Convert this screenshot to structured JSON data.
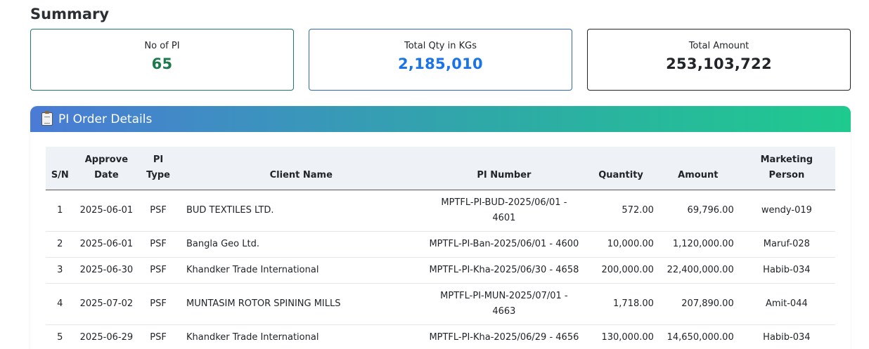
{
  "summary": {
    "title": "Summary",
    "cards": [
      {
        "label": "No of PI",
        "value": "65"
      },
      {
        "label": "Total Qty in KGs",
        "value": "2,185,010"
      },
      {
        "label": "Total Amount",
        "value": "253,103,722"
      }
    ]
  },
  "panel": {
    "icon": "clipboard-icon",
    "title": "PI Order Details"
  },
  "table": {
    "headers": {
      "sn": "S/N",
      "approve_date": "Approve Date",
      "pi_type": "PI Type",
      "client_name": "Client Name",
      "pi_number": "PI Number",
      "quantity": "Quantity",
      "amount": "Amount",
      "marketing_person": "Marketing Person"
    },
    "rows": [
      {
        "sn": "1",
        "date": "2025-06-01",
        "type": "PSF",
        "client": "BUD TEXTILES LTD.",
        "pi": "MPTFL-PI-BUD-2025/06/01 - 4601",
        "qty": "572.00",
        "amount": "69,796.00",
        "person": "wendy-019"
      },
      {
        "sn": "2",
        "date": "2025-06-01",
        "type": "PSF",
        "client": "Bangla Geo Ltd.",
        "pi": "MPTFL-PI-Ban-2025/06/01 - 4600",
        "qty": "10,000.00",
        "amount": "1,120,000.00",
        "person": "Maruf-028"
      },
      {
        "sn": "3",
        "date": "2025-06-30",
        "type": "PSF",
        "client": "Khandker Trade International",
        "pi": "MPTFL-PI-Kha-2025/06/30 - 4658",
        "qty": "200,000.00",
        "amount": "22,400,000.00",
        "person": "Habib-034"
      },
      {
        "sn": "4",
        "date": "2025-07-02",
        "type": "PSF",
        "client": "MUNTASIM ROTOR SPINING MILLS",
        "pi": "MPTFL-PI-MUN-2025/07/01 - 4663",
        "qty": "1,718.00",
        "amount": "207,890.00",
        "person": "Amit-044"
      },
      {
        "sn": "5",
        "date": "2025-06-29",
        "type": "PSF",
        "client": "Khandker Trade International",
        "pi": "MPTFL-PI-Kha-2025/06/29 - 4656",
        "qty": "130,000.00",
        "amount": "14,650,000.00",
        "person": "Habib-034"
      }
    ]
  }
}
